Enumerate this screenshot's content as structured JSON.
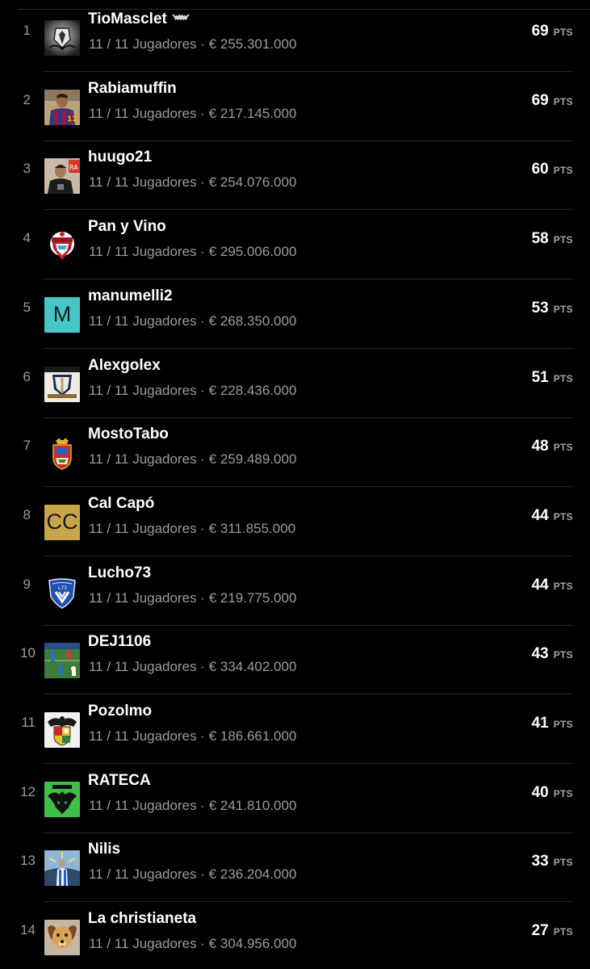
{
  "standings": {
    "points_unit": "PTS",
    "meta_separator": " · ",
    "rows": [
      {
        "rank": "1",
        "name": "TioMasclet",
        "squad": "11 / 11 Jugadores",
        "value": "€ 255.301.000",
        "points": "69",
        "avatar": "batman-crest-image",
        "badge_icon": "bat-icon"
      },
      {
        "rank": "2",
        "name": "Rabiamuffin",
        "squad": "11 / 11 Jugadores",
        "value": "€ 217.145.000",
        "points": "69",
        "avatar": "player-barcelona-photo"
      },
      {
        "rank": "3",
        "name": "huugo21",
        "squad": "11 / 11 Jugadores",
        "value": "€ 254.076.000",
        "points": "60",
        "avatar": "user-photo"
      },
      {
        "rank": "4",
        "name": "Pan y Vino",
        "squad": "11 / 11 Jugadores",
        "value": "€ 295.006.000",
        "points": "58",
        "avatar": "red-crest-image"
      },
      {
        "rank": "5",
        "name": "manumelli2",
        "squad": "11 / 11 Jugadores",
        "value": "€ 268.350.000",
        "points": "53",
        "avatar": "letter-avatar",
        "avatar_letters": "M",
        "avatar_color": "#45c6c9"
      },
      {
        "rank": "6",
        "name": "Alexgolex",
        "squad": "11 / 11 Jugadores",
        "value": "€ 228.436.000",
        "points": "51",
        "avatar": "club-badge-image"
      },
      {
        "rank": "7",
        "name": "MostoTabo",
        "squad": "11 / 11 Jugadores",
        "value": "€ 259.489.000",
        "points": "48",
        "avatar": "coat-of-arms-image"
      },
      {
        "rank": "8",
        "name": "Cal Capó",
        "squad": "11 / 11 Jugadores",
        "value": "€ 311.855.000",
        "points": "44",
        "avatar": "letter-avatar",
        "avatar_letters": "CC",
        "avatar_color": "#c9a44a"
      },
      {
        "rank": "9",
        "name": "Lucho73",
        "squad": "11 / 11 Jugadores",
        "value": "€ 219.775.000",
        "points": "44",
        "avatar": "blue-shield-image"
      },
      {
        "rank": "10",
        "name": "DEJ1106",
        "squad": "11 / 11 Jugadores",
        "value": "€ 334.402.000",
        "points": "43",
        "avatar": "football-pitch-photo"
      },
      {
        "rank": "11",
        "name": "Pozolmo",
        "squad": "11 / 11 Jugadores",
        "value": "€ 186.661.000",
        "points": "41",
        "avatar": "heraldic-eagle-image"
      },
      {
        "rank": "12",
        "name": "RATECA",
        "squad": "11 / 11 Jugadores",
        "value": "€ 241.810.000",
        "points": "40",
        "avatar": "green-bat-logo-image"
      },
      {
        "rank": "13",
        "name": "Nilis",
        "squad": "11 / 11 Jugadores",
        "value": "€ 236.204.000",
        "points": "33",
        "avatar": "stadium-player-image"
      },
      {
        "rank": "14",
        "name": "La christianeta",
        "squad": "11 / 11 Jugadores",
        "value": "€ 304.956.000",
        "points": "27",
        "avatar": "dog-photo"
      }
    ]
  }
}
